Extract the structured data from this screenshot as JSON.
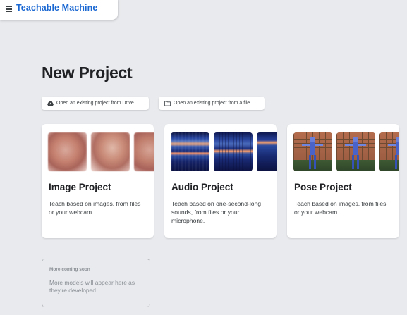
{
  "header": {
    "app_title": "Teachable Machine",
    "menu_icon": "hamburger-menu-icon",
    "accent_color": "#1967d2"
  },
  "page": {
    "title": "New Project"
  },
  "actions": {
    "drive_label": "Open an existing project from Drive.",
    "drive_icon": "google-drive-icon",
    "file_label": "Open an existing project from a file.",
    "file_icon": "folder-icon"
  },
  "cards": [
    {
      "title": "Image Project",
      "description": "Teach based on images, from files or your webcam."
    },
    {
      "title": "Audio Project",
      "description": "Teach based on one-second-long sounds, from files or your microphone."
    },
    {
      "title": "Pose Project",
      "description": "Teach based on images, from files or your webcam."
    }
  ],
  "coming_soon": {
    "title": "More coming soon",
    "description": "More models will appear here as they're developed."
  }
}
